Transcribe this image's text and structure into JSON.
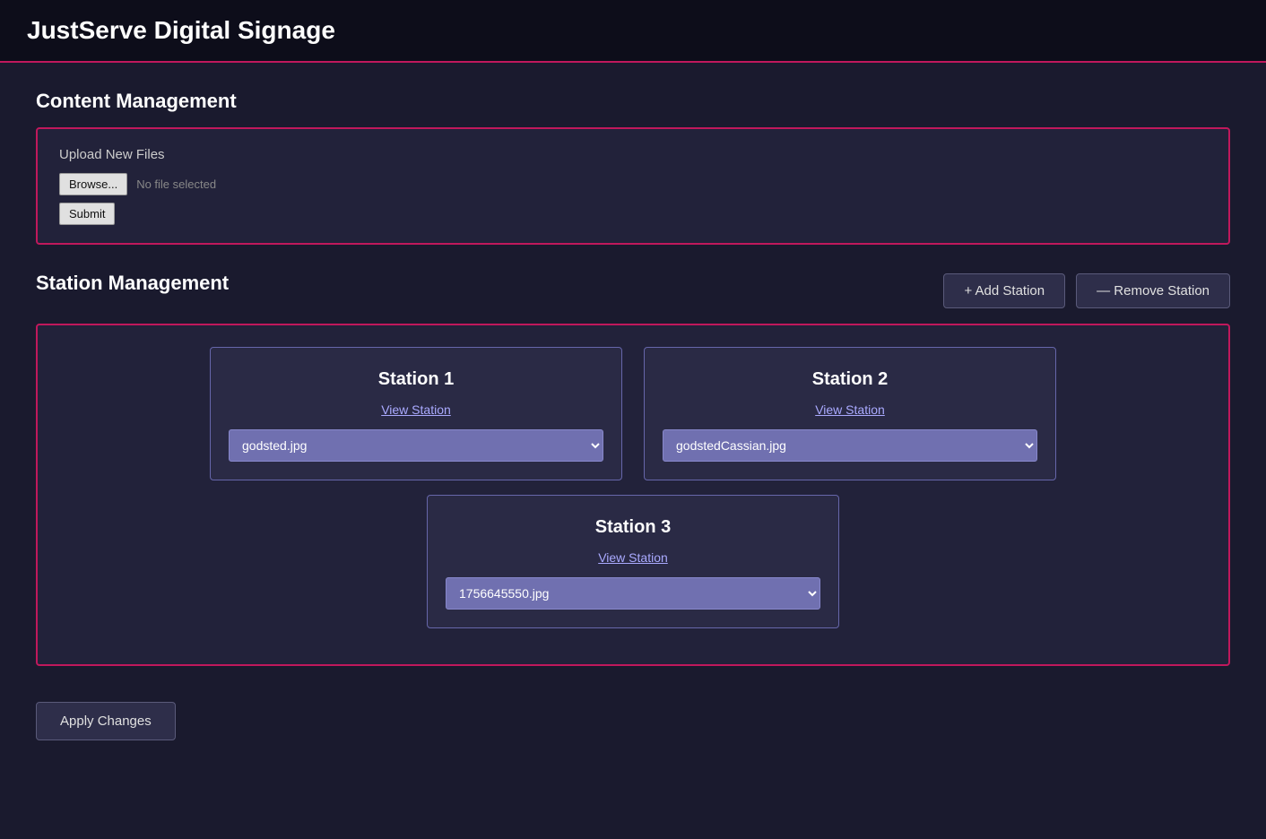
{
  "app": {
    "title": "JustServe Digital Signage"
  },
  "content_management": {
    "section_title": "Content Management",
    "panel": {
      "upload_label": "Upload New Files",
      "browse_button": "Browse...",
      "file_placeholder": "No file selected",
      "submit_button": "Submit"
    }
  },
  "station_management": {
    "section_title": "Station Management",
    "add_station_button": "+ Add Station",
    "remove_station_button": "— Remove Station",
    "stations": [
      {
        "id": "station-1",
        "title": "Station 1",
        "view_link": "View Station",
        "selected_file": "godsted.jpg",
        "options": [
          "godsted.jpg",
          "godstedCassian.jpg",
          "1756645550.jpg"
        ]
      },
      {
        "id": "station-2",
        "title": "Station 2",
        "view_link": "View Station",
        "selected_file": "godstedCassian.jpg",
        "options": [
          "godsted.jpg",
          "godstedCassian.jpg",
          "1756645550.jpg"
        ]
      },
      {
        "id": "station-3",
        "title": "Station 3",
        "view_link": "View Station",
        "selected_file": "1756645550.jpg",
        "options": [
          "godsted.jpg",
          "godstedCassian.jpg",
          "1756645550.jpg"
        ]
      }
    ],
    "apply_changes_button": "Apply Changes"
  }
}
